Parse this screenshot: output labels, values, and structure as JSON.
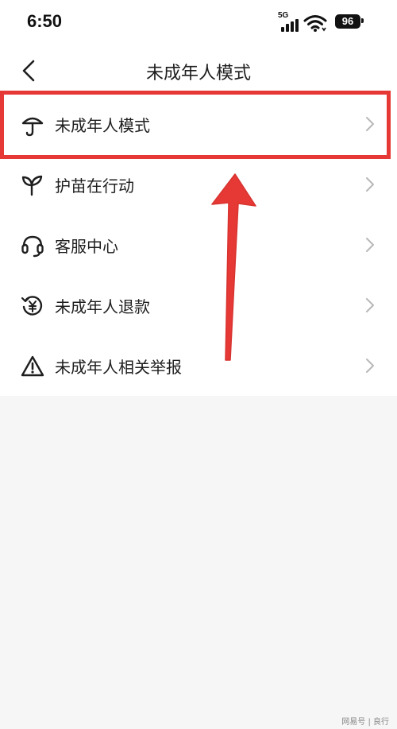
{
  "status_bar": {
    "time": "6:50",
    "network": "5G",
    "battery": "96"
  },
  "header": {
    "title": "未成年人模式"
  },
  "menu": {
    "items": [
      {
        "label": "未成年人模式",
        "icon": "umbrella-icon"
      },
      {
        "label": "护苗在行动",
        "icon": "sprout-icon"
      },
      {
        "label": "客服中心",
        "icon": "headset-icon"
      },
      {
        "label": "未成年人退款",
        "icon": "refund-icon"
      },
      {
        "label": "未成年人相关举报",
        "icon": "warning-icon"
      }
    ]
  },
  "annotation": {
    "color": "#e63935"
  },
  "watermark": "网易号 | 良行"
}
